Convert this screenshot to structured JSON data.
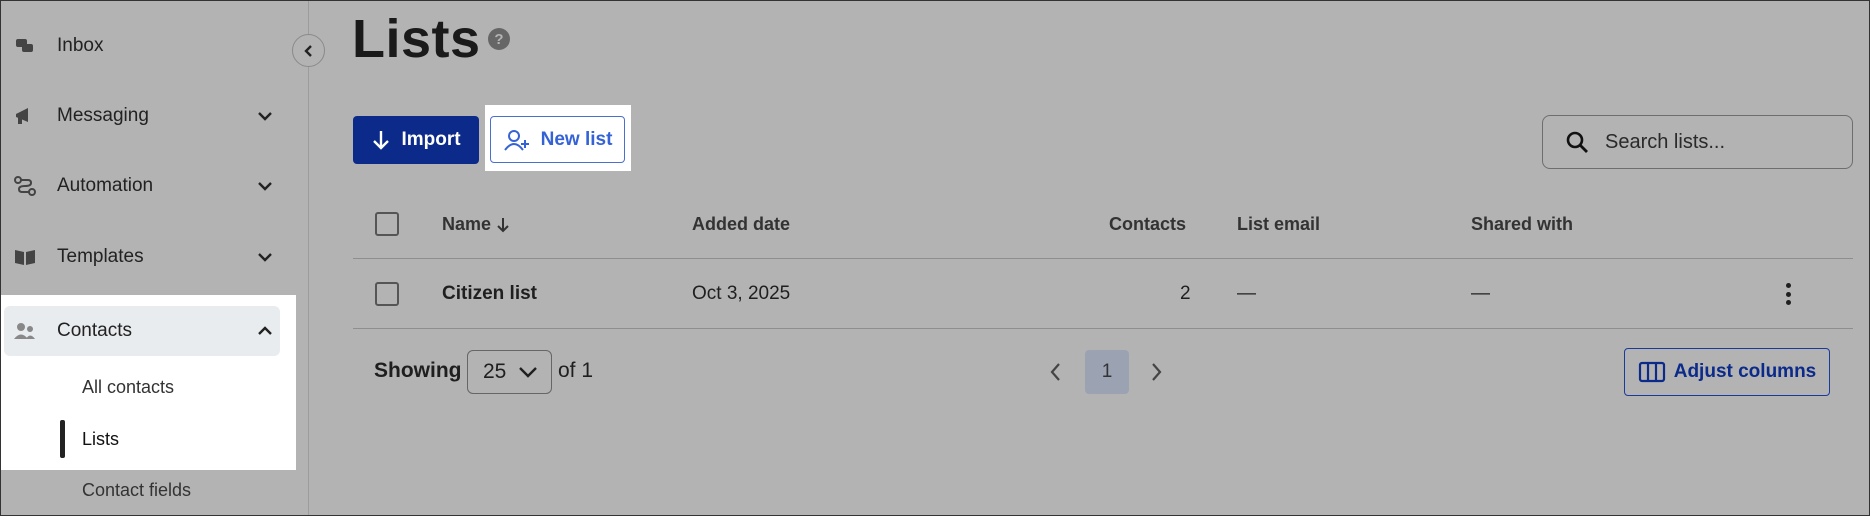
{
  "sidebar": {
    "items": [
      {
        "label": "Inbox",
        "icon": "inbox-icon"
      },
      {
        "label": "Messaging",
        "icon": "megaphone-icon"
      },
      {
        "label": "Automation",
        "icon": "automation-icon"
      },
      {
        "label": "Templates",
        "icon": "book-icon"
      },
      {
        "label": "Contacts",
        "icon": "people-icon"
      }
    ],
    "contacts_sub": [
      "All contacts",
      "Lists",
      "Contact fields"
    ]
  },
  "page": {
    "title": "Lists",
    "help": "?"
  },
  "toolbar": {
    "import_label": "Import",
    "new_list_label": "New list",
    "search_placeholder": "Search lists..."
  },
  "table": {
    "headers": {
      "name": "Name",
      "added_date": "Added date",
      "contacts": "Contacts",
      "list_email": "List email",
      "shared_with": "Shared with"
    },
    "rows": [
      {
        "name": "Citizen list",
        "added_date": "Oct 3, 2025",
        "contacts": "2",
        "list_email": "—",
        "shared_with": "—"
      }
    ]
  },
  "footer": {
    "showing_label": "Showing",
    "per_page": "25",
    "of_total": "of 1",
    "current_page": "1",
    "adjust_columns_label": "Adjust columns"
  },
  "colors": {
    "primary": "#0b2a8a",
    "link": "#3563d6",
    "background": "#b3b3b3"
  }
}
